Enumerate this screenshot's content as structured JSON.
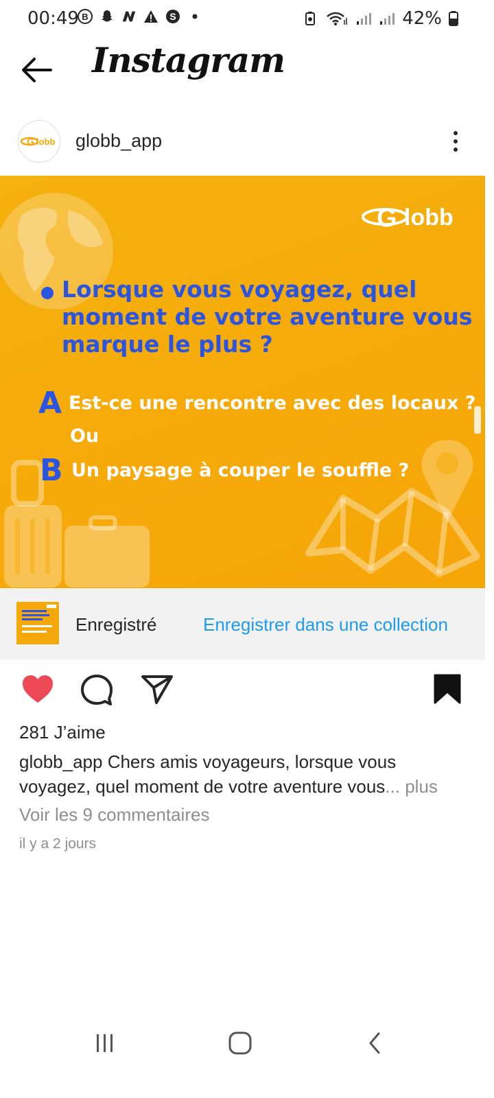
{
  "status_bar": {
    "time": "00:49",
    "battery": "42%",
    "left_icons": [
      "b-circle-icon",
      "snapchat-icon",
      "n-icon",
      "warning-icon",
      "s-circle-icon",
      "dot-icon"
    ],
    "right_icons": [
      "battery-saver-icon",
      "wifi-icon",
      "signal-icon",
      "signal-icon",
      "battery-icon"
    ]
  },
  "header": {
    "title": "Instagram"
  },
  "post": {
    "username": "globb_app",
    "avatar_text": "Globb",
    "image": {
      "logo": "Globb",
      "question": "Lorsque vous voyagez, quel moment de votre aventure vous marque le plus ?",
      "option_a_letter": "A",
      "option_a": "Est-ce une rencontre avec des locaux ?",
      "or_text": "Ou",
      "option_b_letter": "B",
      "option_b": "Un paysage à couper le souffle ?",
      "background_color": "#f5ab0b",
      "question_color": "#2b55e0"
    },
    "saved_bar": {
      "label": "Enregistré",
      "link": "Enregistrer dans une collection"
    },
    "likes": "281 J’aime",
    "caption_user": "globb_app",
    "caption_text": " Chers amis voyageurs, lorsque vous voyagez, quel moment de votre aventure vous",
    "caption_more": "... plus",
    "comments": "Voir les 9 commentaires",
    "time_ago": "il y a 2 jours"
  },
  "colors": {
    "like": "#ed4956",
    "link": "#1e9bf0"
  }
}
